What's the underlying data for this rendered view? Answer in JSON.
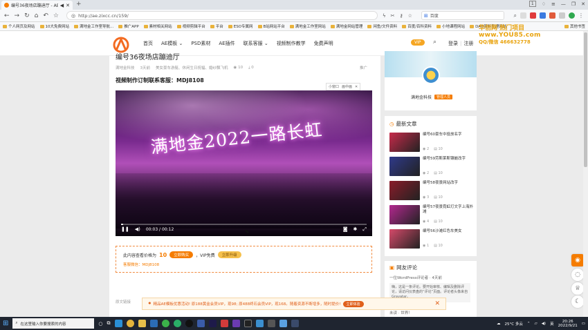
{
  "browser": {
    "tab_title": "编号36夜场店蹦迪厅 - AE模板",
    "page_num": "1",
    "url": "http://ae.zixcc.cn/159/",
    "search_engine_label": "百度"
  },
  "bookmarks": [
    "个人网页及网站",
    "10大免费网站",
    "满地金工作室导航...",
    "推广APP",
    "素材相关网站",
    "视频剪辑平台",
    "平台",
    "ESO专属网",
    "B站网站平台",
    "满地金工作室网站",
    "满地金网站管理",
    "闲鱼/文件资料",
    "百度/百科资料",
    "小地课程网站",
    "DAO资料整理网站"
  ],
  "bookmarks_more": "其他书签",
  "site": {
    "nav": [
      "首页",
      "AE模板",
      "PSD素材",
      "AE插件",
      "联系客服",
      "视频制作教学",
      "免费声明"
    ],
    "vip": "VIP",
    "login": "登录",
    "register": "注册",
    "watermark_line1": "华创网 热门项目",
    "watermark_line2": "www.YOU85.com",
    "watermark_line3": "QQ/微信 466632778"
  },
  "article": {
    "title": "编号36夜场店蹦迪厅",
    "meta": [
      "满地金科技",
      "3天前",
      "美女豪车游艇、休闲生日祝福、婚纱飘飞机",
      "10",
      "0"
    ],
    "tip": "推广",
    "subheading": "视频制作订制联系客服：MDJ8108",
    "pip": [
      "小窗口",
      "画中画"
    ],
    "video_text": "满地金2022一路长虹",
    "time": "00:03 / 00:12",
    "price_prefix": "此内容查看价格为",
    "price": "10",
    "buy_label": "立即购买",
    "vip_free": "，VIP免费",
    "vip_btn": "立即升级",
    "email_label": "客服微信：MDJ8108",
    "comment_note": "原文链接"
  },
  "sidebar": {
    "user_name": "满地金科技",
    "user_role": "管理人员",
    "latest_heading": "最新文章",
    "posts": [
      {
        "title": "编号60豪车中投放名字",
        "views": "2",
        "comments": "10",
        "color": "#c72a4a"
      },
      {
        "title": "编号59劳斯莱斯镶嵌改字",
        "views": "2",
        "comments": "10",
        "color": "#2f3a8a"
      },
      {
        "title": "编号58夜景网站改字",
        "views": "3",
        "comments": "10",
        "color": "#8a1c2a"
      },
      {
        "title": "编号57夜景霓虹灯文字上海外滩",
        "views": "4",
        "comments": "10",
        "color": "#b3288f"
      },
      {
        "title": "编号56沙滩红色车美女",
        "views": "1",
        "comments": "10",
        "color": "#d64a6a"
      }
    ],
    "comments_heading": "网友评论",
    "comments_by": "一位WordPress评论者 · 4天前",
    "comments_body": "嗨，这是一条评论。要开始审核、编辑及删除评论，请访问仪表盘的“评论”页面。评论者头像来自Gravatar。",
    "comments_foot": "未读 · 世界！"
  },
  "promo": {
    "text": "精品AE模板优惠活动! 原188黄金会员VIP，现98; 原488终石会员VIP，现168。随着资源不断增多，随时提价!",
    "button": "立即体验"
  },
  "taskbar": {
    "search_placeholder": "在这里输入你要搜索的内容",
    "weather": "25°C 多云",
    "ime": "英",
    "time": "20:26",
    "date": "2022/9/21"
  },
  "colors": {
    "accent": "#f57c00",
    "video_glow": "#e060e0",
    "taskbar": "#1f2530"
  }
}
